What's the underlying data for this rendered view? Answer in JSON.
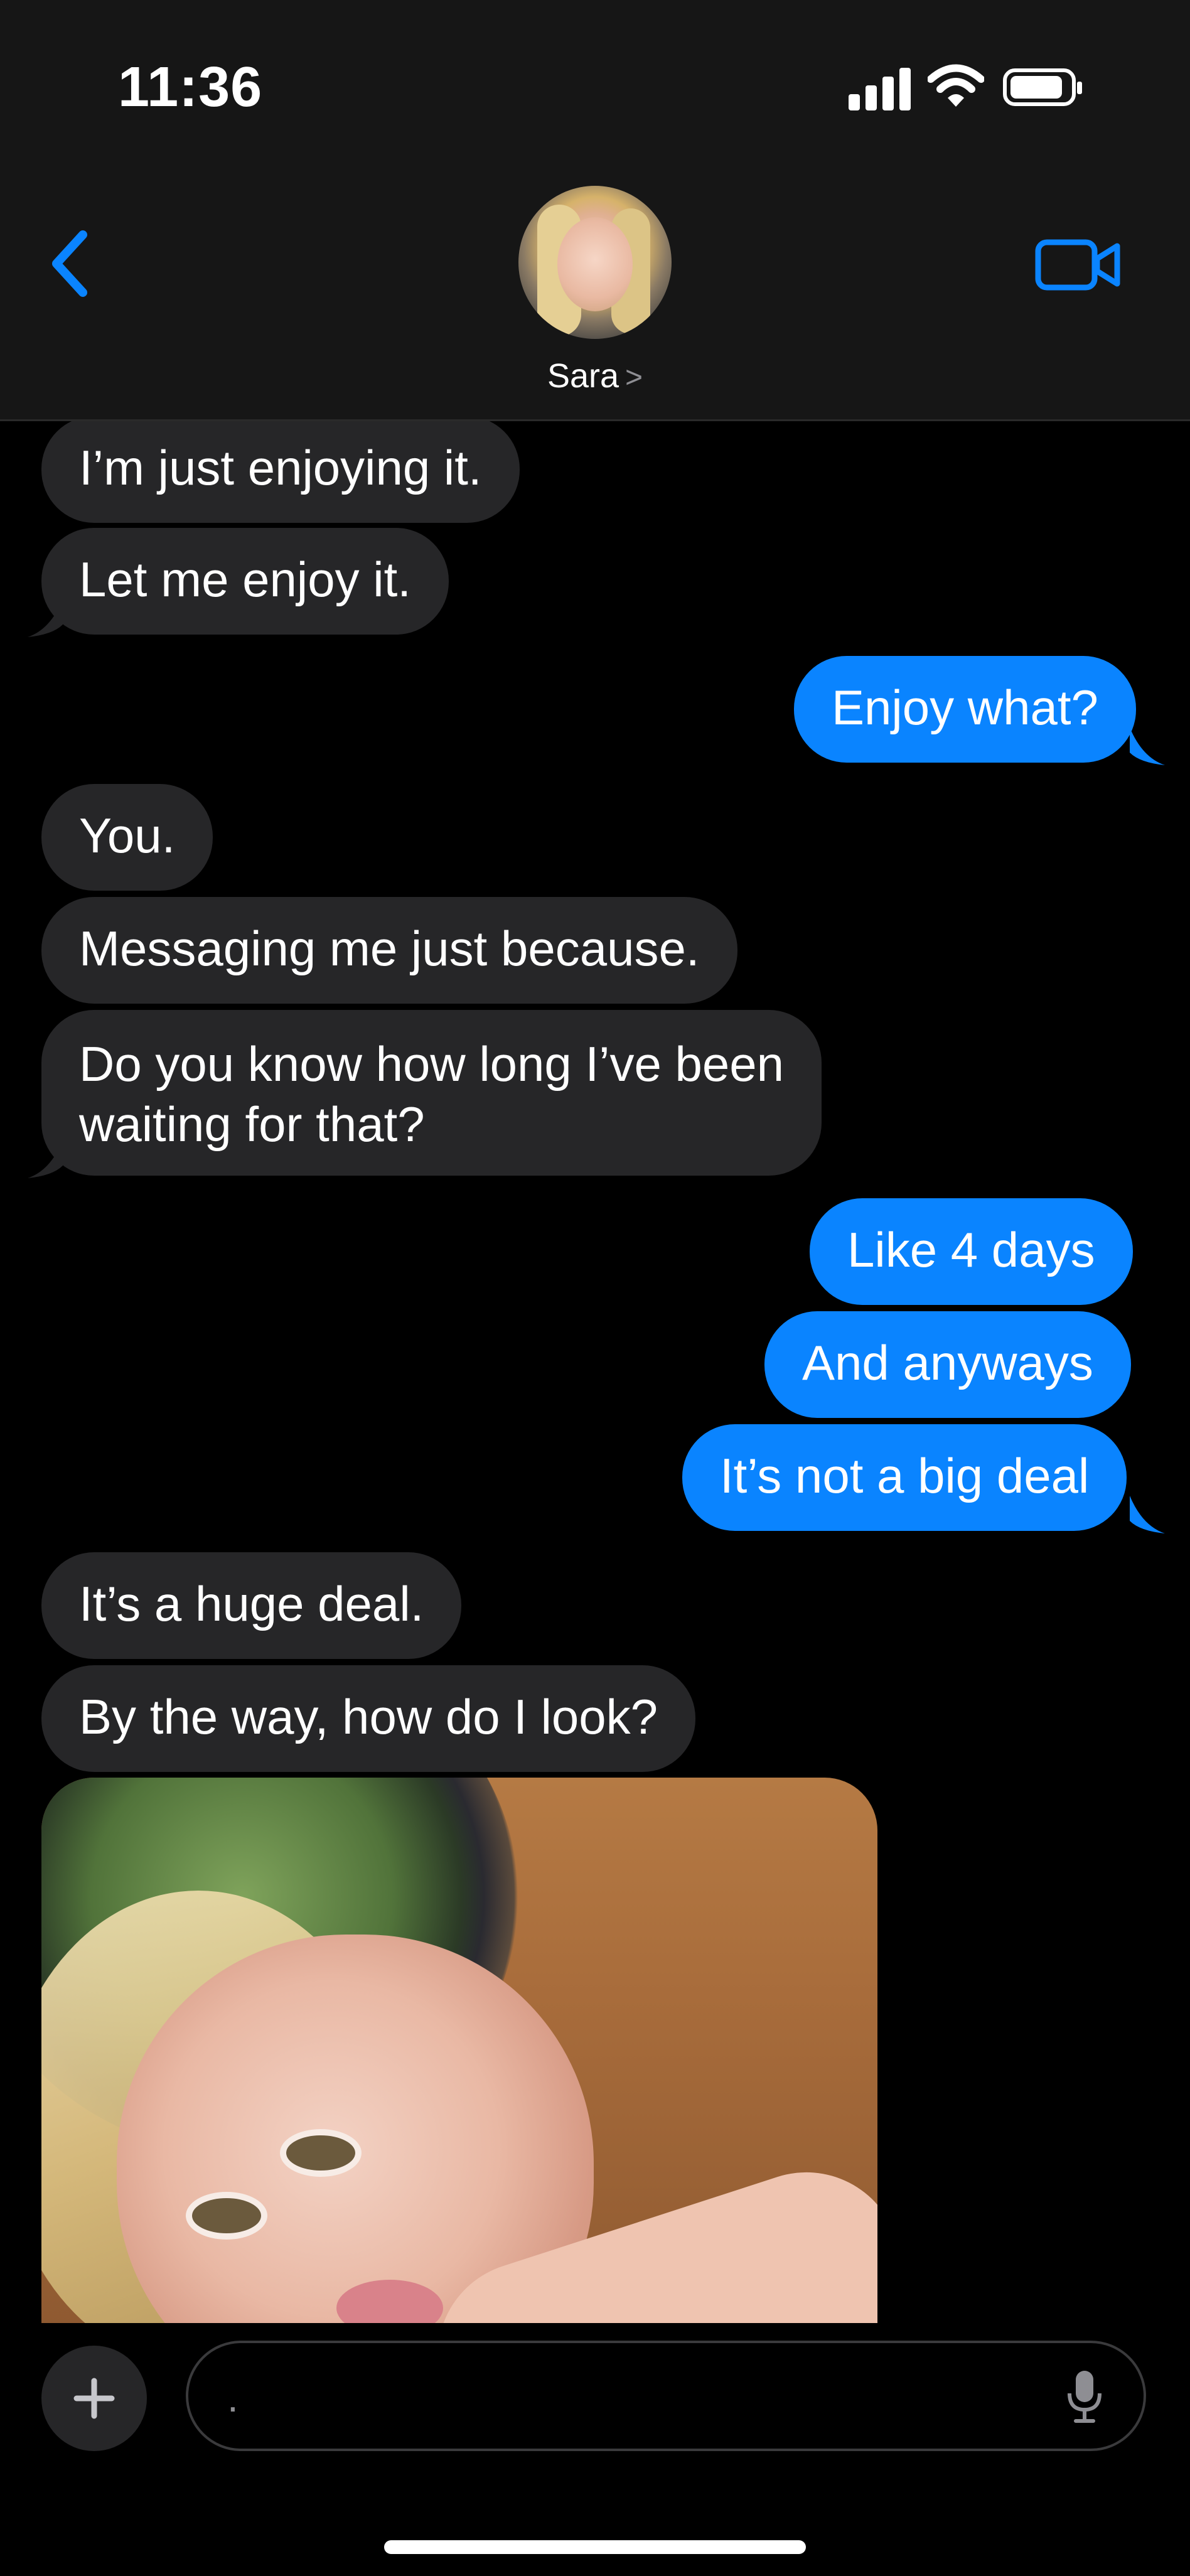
{
  "status_bar": {
    "time": "11:36"
  },
  "header": {
    "contact_name": "Sara",
    "contact_chevron": ">"
  },
  "messages": [
    {
      "from": "them",
      "text": "I’m just enjoying it."
    },
    {
      "from": "them",
      "text": "Let me enjoy it."
    },
    {
      "from": "me",
      "text": "Enjoy what?"
    },
    {
      "from": "them",
      "text": "You."
    },
    {
      "from": "them",
      "text": "Messaging me just because."
    },
    {
      "from": "them",
      "text": "Do you know how long I’ve been",
      "text2": "waiting for that?"
    },
    {
      "from": "me",
      "text": "Like 4 days"
    },
    {
      "from": "me",
      "text": "And anyways"
    },
    {
      "from": "me",
      "text": "It’s not a big deal"
    },
    {
      "from": "them",
      "text": "It’s a huge deal."
    },
    {
      "from": "them",
      "text": "By the way, how do I look?"
    }
  ],
  "composer": {
    "input_value": "."
  },
  "colors": {
    "outgoing": "#0a84ff",
    "incoming": "#262628",
    "accent": "#0a84ff"
  },
  "icons": [
    "back-chevron-icon",
    "video-call-icon",
    "plus-icon",
    "microphone-icon",
    "signal-icon",
    "wifi-icon",
    "battery-icon"
  ]
}
